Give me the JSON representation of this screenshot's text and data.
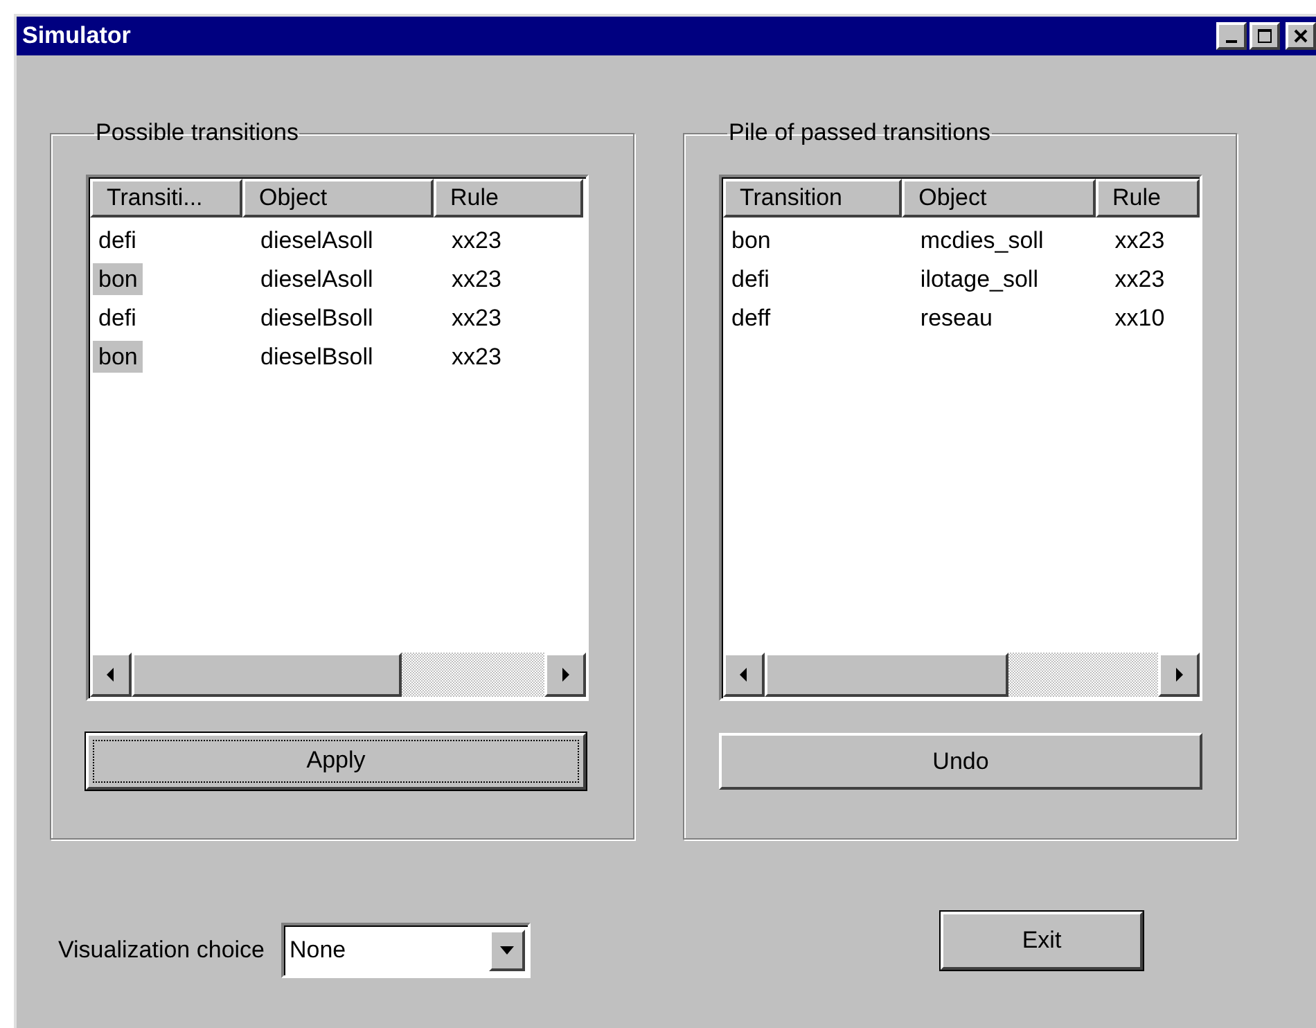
{
  "window": {
    "title": "Simulator"
  },
  "panels": [
    {
      "title": "Possible transitions",
      "columns": [
        "Transiti...",
        "Object",
        "Rule"
      ],
      "rows": [
        {
          "cells": [
            "defi",
            "dieselAsoll",
            "xx23"
          ],
          "selected": false
        },
        {
          "cells": [
            "bon",
            "dieselAsoll",
            "xx23"
          ],
          "selected": true
        },
        {
          "cells": [
            "defi",
            "dieselBsoll",
            "xx23"
          ],
          "selected": false
        },
        {
          "cells": [
            "bon",
            "dieselBsoll",
            "xx23"
          ],
          "selected": true
        }
      ],
      "button": {
        "label": "Apply",
        "focused": true
      }
    },
    {
      "title": "Pile of passed transitions",
      "columns": [
        "Transition",
        "Object",
        "Rule"
      ],
      "rows": [
        {
          "cells": [
            "bon",
            "mcdies_soll",
            "xx23"
          ],
          "selected": false
        },
        {
          "cells": [
            "defi",
            "ilotage_soll",
            "xx23"
          ],
          "selected": false
        },
        {
          "cells": [
            "deff",
            "reseau",
            "xx10"
          ],
          "selected": false
        }
      ],
      "button": {
        "label": "Undo",
        "focused": false
      }
    }
  ],
  "visualization": {
    "label": "Visualization choice",
    "value": "None"
  },
  "exit_button": {
    "label": "Exit"
  }
}
